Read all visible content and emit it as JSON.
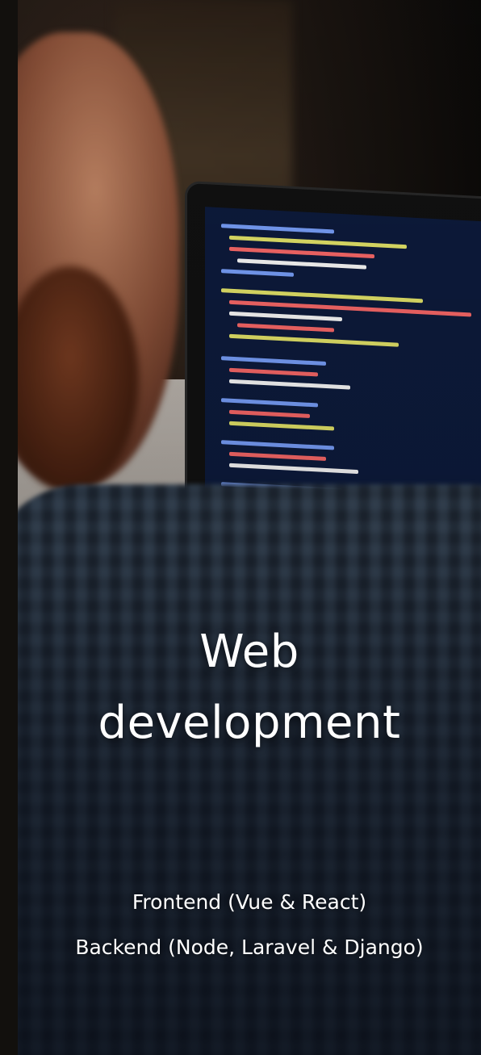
{
  "card": {
    "title_line1": "Web",
    "title_line2": "development",
    "services": [
      "Frontend (Vue & React)",
      "Backend (Node, Laravel & Django)"
    ]
  }
}
